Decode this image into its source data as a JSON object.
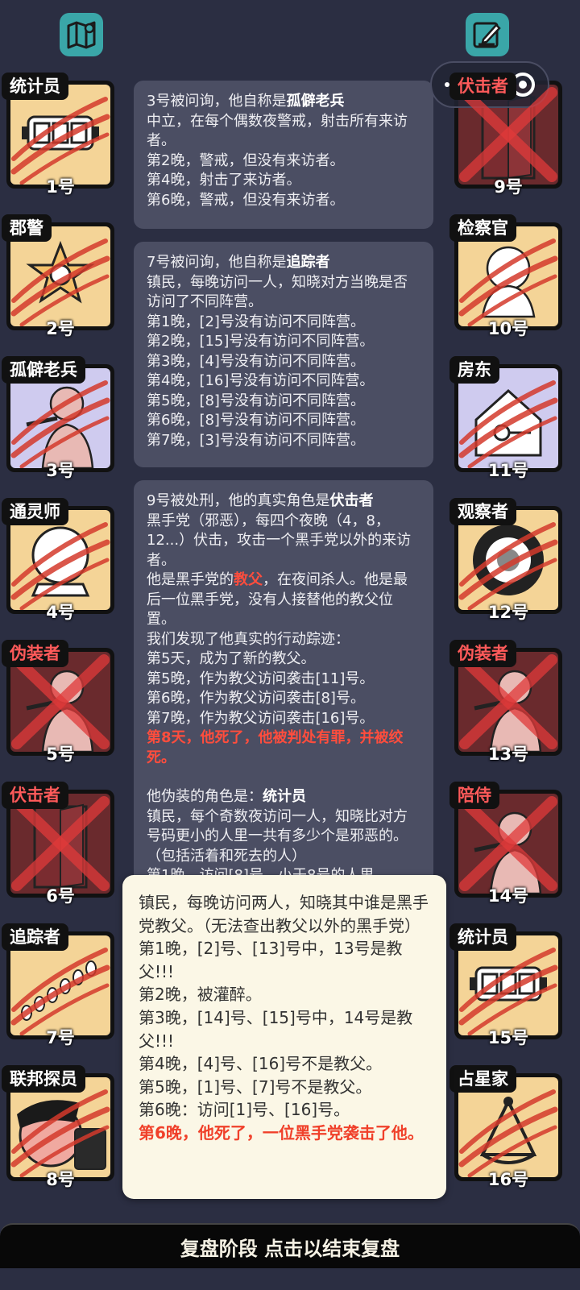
{
  "header": {
    "left_icon": "map-icon",
    "right_icon": "notepad-pen-icon"
  },
  "mini_program_capsule": {
    "menu_icon": "more-dots-icon",
    "close_icon": "target-close-icon"
  },
  "left_players": [
    {
      "role": "统计员",
      "number": "1号",
      "alive": true
    },
    {
      "role": "郡警",
      "number": "2号",
      "alive": true
    },
    {
      "role": "孤僻老兵",
      "number": "3号",
      "alive": true
    },
    {
      "role": "通灵师",
      "number": "4号",
      "alive": true
    },
    {
      "role": "伪装者",
      "number": "5号",
      "alive": false
    },
    {
      "role": "伏击者",
      "number": "6号",
      "alive": false
    },
    {
      "role": "追踪者",
      "number": "7号",
      "alive": true
    },
    {
      "role": "联邦探员",
      "number": "8号",
      "alive": true
    }
  ],
  "right_players": [
    {
      "role": "伏击者",
      "number": "9号",
      "alive": false
    },
    {
      "role": "检察官",
      "number": "10号",
      "alive": true
    },
    {
      "role": "房东",
      "number": "11号",
      "alive": true
    },
    {
      "role": "观察者",
      "number": "12号",
      "alive": true
    },
    {
      "role": "伪装者",
      "number": "13号",
      "alive": false
    },
    {
      "role": "陪侍",
      "number": "14号",
      "alive": false
    },
    {
      "role": "统计员",
      "number": "15号",
      "alive": true
    },
    {
      "role": "占星家",
      "number": "16号",
      "alive": true
    }
  ],
  "messages": {
    "m1": {
      "prefix": "3号被问询，他自称是",
      "role": "孤僻老兵",
      "lines": [
        "中立，在每个偶数夜警戒，射击所有来访者。",
        "第2晚，警戒，但没有来访者。",
        "第4晚，射击了来访者。",
        "第6晚，警戒，但没有来访者。"
      ]
    },
    "m2": {
      "prefix": "7号被问询，他自称是",
      "role": "追踪者",
      "lines": [
        "镇民，每晚访问一人，知晓对方当晚是否访问了不同阵营。",
        "第1晚，[2]号没有访问不同阵营。",
        "第2晚，[15]号没有访问不同阵营。",
        "第3晚，[4]号没有访问不同阵营。",
        "第4晚，[16]号没有访问不同阵营。",
        "第5晚，[8]号没有访问不同阵营。",
        "第6晚，[8]号没有访问不同阵营。",
        "第7晚，[3]号没有访问不同阵营。"
      ]
    },
    "m3": {
      "prefix": "9号被处刑，他的真实角色是",
      "role": "伏击者",
      "desc": "黑手党（邪恶），每四个夜晚（4，8，12...）伏击，攻击一个黑手党以外的来访者。",
      "godfather_prefix": "他是黑手党的",
      "godfather_role": "教父",
      "godfather_suffix": "，在夜间杀人。他是最后一位黑手党，没有人接替他的教父位置。",
      "trace_lines": [
        "我们发现了他真实的行动踪迹：",
        "第5天，成为了新的教父。",
        "第5晚，作为教父访问袭击[11]号。",
        "第6晚，作为教父访问袭击[8]号。",
        "第7晚，作为教父访问袭击[16]号。"
      ],
      "death": "第8天，他死了，他被判处有罪，并被绞死。",
      "disguise_prefix": "他伪装的角色是：",
      "disguise_role": "统计员",
      "disguise_lines": [
        "镇民，每个奇数夜访问一人，知晓比对方号码更小的人里一共有多少个是邪恶的。（包括活着和死去的人）",
        "第1晚，访问[8]号，小于8号的人里"
      ]
    }
  },
  "popup": {
    "lines": [
      "镇民，每晚访问两人，知晓其中谁是黑手党教父。（无法查出教父以外的黑手党）",
      "第1晚，[2]号、[13]号中，13号是教父!!!",
      "第2晚，被灌醉。",
      "第3晚，[14]号、[15]号中，14号是教父!!!",
      "第4晚，[4]号、[16]号不是教父。",
      "第5晚，[1]号、[7]号不是教父。",
      "第6晚：访问[1]号、[16]号。"
    ],
    "death": "第6晚，他死了，一位黑手党袭击了他。"
  },
  "bottom_bar": {
    "label": "复盘阶段 点击以结束复盘"
  },
  "colors": {
    "background": "#2b2e42",
    "card_alive": "#f4d497",
    "card_dead": "#6a2a2d",
    "accent_teal": "#3aa6a8",
    "death_red": "#ff4d3d"
  }
}
